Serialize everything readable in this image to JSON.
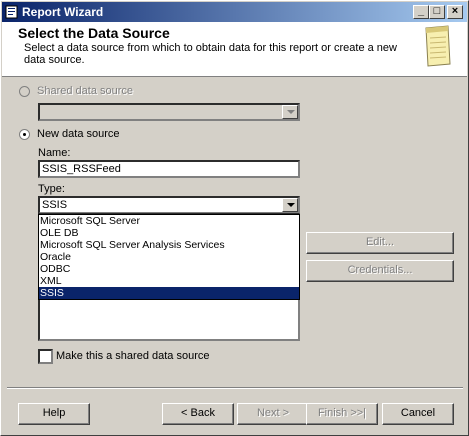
{
  "window": {
    "title": "Report Wizard",
    "minimize_glyph": "_",
    "maximize_glyph": "□",
    "close_glyph": "×"
  },
  "header": {
    "title": "Select the Data Source",
    "description": "Select a data source from which to obtain data for this report or create a new data source.",
    "icon": "wizard-notepad-icon"
  },
  "shared_source": {
    "label": "Shared data source",
    "selected": false,
    "enabled": false,
    "value": ""
  },
  "new_source": {
    "label": "New data source",
    "selected": true,
    "name_label": "Name:",
    "name_value": "SSIS_RSSFeed",
    "type_label": "Type:",
    "type_value": "SSIS",
    "type_options": [
      "Microsoft SQL Server",
      "OLE DB",
      "Microsoft SQL Server Analysis Services",
      "Oracle",
      "ODBC",
      "XML",
      "SSIS"
    ],
    "selected_option": "SSIS"
  },
  "side_buttons": {
    "edit": "Edit...",
    "credentials": "Credentials..."
  },
  "shared_checkbox": {
    "label": "Make this a shared data source",
    "checked": false
  },
  "footer": {
    "help": "Help",
    "back": "< Back",
    "next": "Next >",
    "finish": "Finish >>|",
    "cancel": "Cancel"
  },
  "colors": {
    "title_active": "#0a246a",
    "face": "#d4d0c8",
    "selection": "#0a246a"
  }
}
